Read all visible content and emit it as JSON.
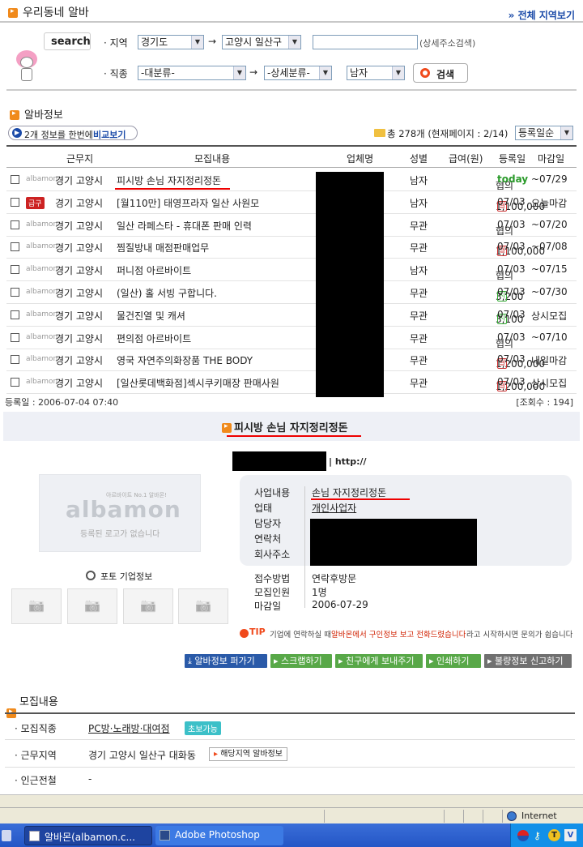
{
  "header": {
    "title": "우리동네 알바",
    "all_region_link": "» 전체 지역보기"
  },
  "search": {
    "logo_text": "search",
    "region_label": "· 지역",
    "region_select1": "경기도",
    "region_select2": "고양시 일산구",
    "address_placeholder": "",
    "address_hint": "(상세주소검색)",
    "job_label": "· 직종",
    "job_select1": "-대분류-",
    "job_select2": "-상세분류-",
    "gender_select": "남자",
    "search_button": "검색"
  },
  "jobinfo": {
    "section_title": "알바정보",
    "compare_text": "2개 정보를 한번에",
    "compare_link": "비교보기",
    "total_text": "총 278개 (현재페이지 : 2/14)",
    "sort_select": "등록일순",
    "columns": [
      "근무지",
      "모집내용",
      "업체명",
      "성별",
      "급여(원)",
      "등록일",
      "마감일"
    ],
    "rows": [
      {
        "tag": "albamon",
        "loc": "경기 고양시",
        "title": "피시방 손님 자지정리정돈",
        "gender": "남자",
        "pay": "협의",
        "paytype": "",
        "reg": "today",
        "deadline": "~07/29"
      },
      {
        "tag": "급구",
        "loc": "경기 고양시",
        "title": "[월110만] 태영프라자 일산 사원모",
        "gender": "남자",
        "pay": "1,100,000",
        "paytype": "월",
        "reg": "07/03",
        "deadline": "오늘마감"
      },
      {
        "tag": "albamon",
        "loc": "경기 고양시",
        "title": "일산 라페스타 - 휴대폰 판매 인력",
        "gender": "무관",
        "pay": "협의",
        "paytype": "",
        "reg": "07/03",
        "deadline": "~07/20"
      },
      {
        "tag": "albamon",
        "loc": "경기 고양시",
        "title": "찜질방내 매점판매업무",
        "gender": "무관",
        "pay": "1,100,000",
        "paytype": "월",
        "reg": "07/03",
        "deadline": "~07/08"
      },
      {
        "tag": "albamon",
        "loc": "경기 고양시",
        "title": "퍼니점 아르바이트",
        "gender": "남자",
        "pay": "협의",
        "paytype": "",
        "reg": "07/03",
        "deadline": "~07/15"
      },
      {
        "tag": "albamon",
        "loc": "경기 고양시",
        "title": "(일산) 홀 서빙 구합니다.",
        "gender": "무관",
        "pay": "3,200",
        "paytype": "시",
        "reg": "07/03",
        "deadline": "~07/30"
      },
      {
        "tag": "albamon",
        "loc": "경기 고양시",
        "title": "물건진열 및 캐셔",
        "gender": "무관",
        "pay": "3,100",
        "paytype": "시",
        "reg": "07/03",
        "deadline": "상시모집"
      },
      {
        "tag": "albamon",
        "loc": "경기 고양시",
        "title": "편의점 아르바이트",
        "gender": "무관",
        "pay": "협의",
        "paytype": "",
        "reg": "07/03",
        "deadline": "~07/10"
      },
      {
        "tag": "albamon",
        "loc": "경기 고양시",
        "title": "영국 자연주의화장품 THE BODY",
        "gender": "무관",
        "pay": "1,200,000",
        "paytype": "월",
        "reg": "07/03",
        "deadline": "내일마감"
      },
      {
        "tag": "albamon",
        "loc": "경기 고양시",
        "title": "[일산롯데백화점]섹시쿠키매장 판매사원",
        "gender": "무관",
        "pay": "1,200,000",
        "paytype": "월",
        "reg": "07/03",
        "deadline": "상시모집"
      }
    ]
  },
  "detail": {
    "reg_date": "등록일 : 2006-07-04 07:40",
    "view_count": "[조회수 : 194]",
    "title": "피시방 손님 자지정리정돈",
    "url_label": "| http://",
    "logo_slogan": "아르바이트 No.1 알바몬!",
    "logo_brand": "albamon",
    "logo_note": "등록된 로고가 없습니다",
    "photo_info": "포토 기업정보",
    "fields": [
      {
        "label": "사업내용",
        "value": "손님 자지정리정돈"
      },
      {
        "label": "업태",
        "value": "개인사업자"
      },
      {
        "label": "담당자",
        "value": ""
      },
      {
        "label": "연락처",
        "value": ""
      },
      {
        "label": "회사주소",
        "value": ""
      }
    ],
    "fields2": [
      {
        "label": "접수방법",
        "value": "연락후방문"
      },
      {
        "label": "모집인원",
        "value": "1명"
      },
      {
        "label": "마감일",
        "value": "2006-07-29"
      }
    ],
    "tip_label": "TIP",
    "tip_text1": "기업에 연락하실 때",
    "tip_text2": "알바몬에서 구인정보 보고 전화드렸습니다",
    "tip_text3": "라고 시작하시면 문의가 쉽습니다",
    "buttons": [
      "알바정보 퍼가기",
      "스크랩하기",
      "친구에게 보내주기",
      "인쇄하기",
      "불량정보 신고하기"
    ]
  },
  "recruit": {
    "section_title": "모집내용",
    "job_label": "· 모집직종",
    "job_value": "PC방·노래방·대여점",
    "beginner_badge": "초보가능",
    "area_label": "· 근무지역",
    "area_value": "경기 고양시 일산구 대화동",
    "area_link": "해당지역 알바정보",
    "nearby_label": "· 인근전철",
    "nearby_value": "-"
  },
  "statusbar": {
    "zone": "Internet"
  },
  "taskbar": {
    "task1": "알바몬(albamon.c...",
    "task2": "Adobe Photoshop"
  },
  "colors": {
    "accent_blue": "#1a4aa8",
    "accent_orange": "#f08a1c",
    "today_green": "#2a9a2a"
  }
}
